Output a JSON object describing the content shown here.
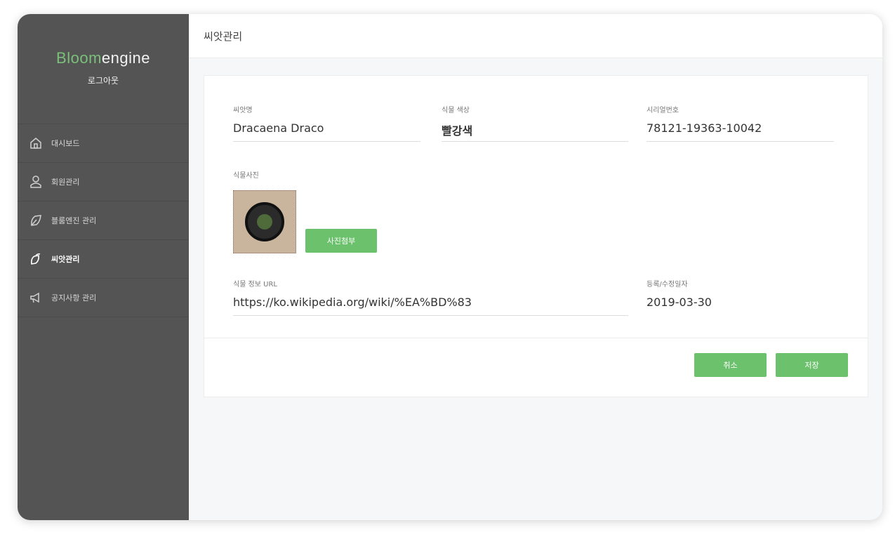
{
  "sidebar": {
    "logo_part1": "Bloom",
    "logo_part2": "engine",
    "logout": "로그아웃",
    "items": [
      {
        "label": "대시보드",
        "icon": "home-icon"
      },
      {
        "label": "회원관리",
        "icon": "user-icon"
      },
      {
        "label": "블룸엔진 관리",
        "icon": "pot-icon"
      },
      {
        "label": "씨앗관리",
        "icon": "seed-icon"
      },
      {
        "label": "공지사항 관리",
        "icon": "megaphone-icon"
      }
    ]
  },
  "header": {
    "title": "씨앗관리"
  },
  "form": {
    "seed_name_label": "씨앗명",
    "seed_name_value": "Dracaena Draco",
    "plant_color_label": "식물 색상",
    "plant_color_value": "빨강색",
    "serial_label": "시리얼번호",
    "serial_value": "78121-19363-10042",
    "photo_label": "식물사진",
    "attach_button": "사진첨부",
    "url_label": "식물 정보 URL",
    "url_value": "https://ko.wikipedia.org/wiki/%EA%BD%83",
    "date_label": "등록/수정일자",
    "date_value": "2019-03-30"
  },
  "actions": {
    "cancel": "취소",
    "save": "저장"
  },
  "colors": {
    "accent": "#6cc26c",
    "sidebar_bg": "#545454",
    "logo_green": "#7ac07a"
  }
}
